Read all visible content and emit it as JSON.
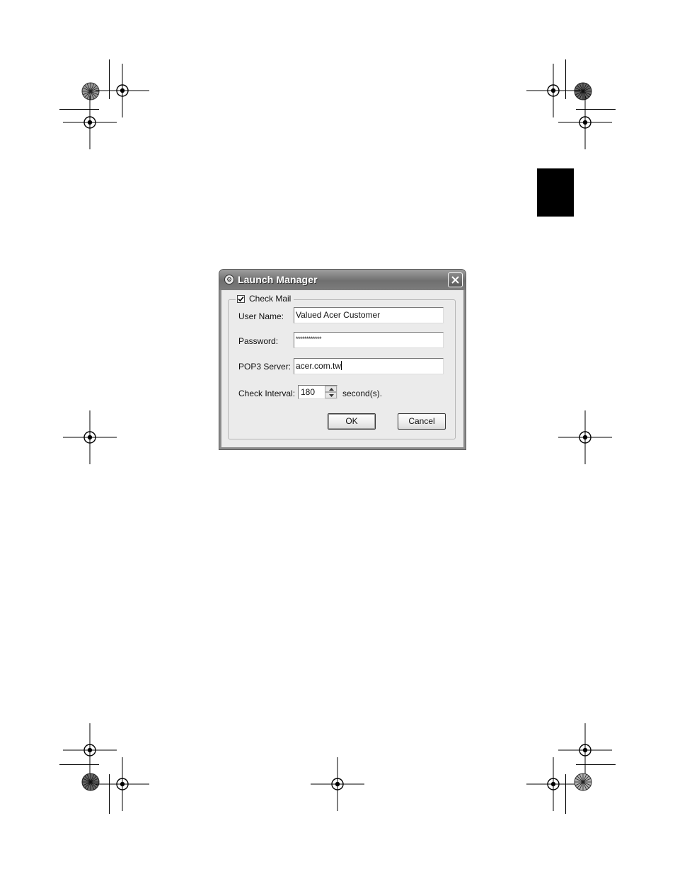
{
  "dialog": {
    "title": "Launch Manager",
    "group_label": "Check Mail",
    "check_mail_checked": true,
    "fields": {
      "user_name": {
        "label": "User Name:",
        "value": "Valued Acer Customer"
      },
      "password": {
        "label": "Password:",
        "value": "************"
      },
      "pop3_server": {
        "label": "POP3 Server:",
        "value": "acer.com.tw"
      }
    },
    "interval": {
      "label": "Check Interval:",
      "value": "180",
      "unit": "second(s)."
    },
    "buttons": {
      "ok": "OK",
      "cancel": "Cancel"
    }
  },
  "icons": {
    "title": "launch-manager-icon",
    "close": "close-icon",
    "check": "checkmark-icon",
    "spin_up": "spin-up-icon",
    "spin_down": "spin-down-icon"
  },
  "colors": {
    "titlebar": "#7d7d7d",
    "dialog_bg": "#ebebeb",
    "page_bg": "#ffffff",
    "tab_marker": "#000000"
  }
}
